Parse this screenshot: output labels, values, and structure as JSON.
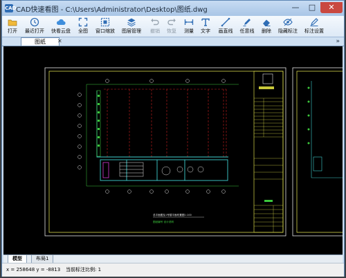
{
  "window": {
    "title": "CAD快速看图 - C:\\Users\\Administrator\\Desktop\\图纸.dwg",
    "app_icon_text": "CAD",
    "minimize_label": "—",
    "maximize_label": "□",
    "close_label": "✕"
  },
  "toolbar": {
    "items": [
      {
        "label": "打开",
        "icon": "folder-icon"
      },
      {
        "label": "最近打开",
        "icon": "clock-icon"
      },
      {
        "label": "快看云盘",
        "icon": "cloud-icon"
      },
      {
        "label": "全图",
        "icon": "fullscreen-icon"
      },
      {
        "label": "窗口缩放",
        "icon": "zoom-window-icon"
      },
      {
        "label": "图层管理",
        "icon": "layers-icon"
      },
      {
        "label": "撤销",
        "icon": "undo-icon",
        "disabled": true
      },
      {
        "label": "恢复",
        "icon": "redo-icon",
        "disabled": true
      },
      {
        "label": "测量",
        "icon": "measure-icon"
      },
      {
        "label": "文字",
        "icon": "text-icon"
      },
      {
        "label": "画直线",
        "icon": "line-icon"
      },
      {
        "label": "任意线",
        "icon": "pen-icon"
      },
      {
        "label": "删除",
        "icon": "eraser-icon"
      },
      {
        "label": "隐藏标注",
        "icon": "eye-icon"
      },
      {
        "label": "标注设置",
        "icon": "settings-pen-icon"
      }
    ]
  },
  "tabs": {
    "active_tab": "图纸",
    "close_label": "✕",
    "overflow_label": "»"
  },
  "layout_tabs": [
    "模型",
    "布局1"
  ],
  "status": {
    "coords": "x = 258648  y = -8813",
    "scale": "当前标注比例: 1"
  },
  "drawing": {
    "title_text": "总平面图及1号楼平面布置图1:100",
    "subtitle_text": "图纸编号  设计说明"
  },
  "colors": {
    "accent": "#2f6db5",
    "canvas": "#000000",
    "frame_yellow": "#d8d84a",
    "frame_white": "#e6e6e6",
    "grid_red": "#c81e1e",
    "wall_cyan": "#3fd0d0",
    "wall_green": "#3cc83c"
  }
}
